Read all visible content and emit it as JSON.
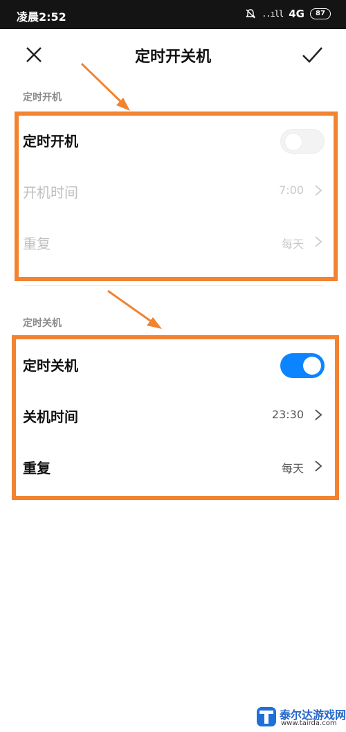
{
  "status_bar": {
    "time": "凌晨2:52",
    "signal_text": "..ıll",
    "network": "4G",
    "battery": "87",
    "icons": [
      "alarm-off-icon",
      "signal-icon",
      "battery-icon"
    ]
  },
  "header": {
    "title": "定时开关机",
    "close_icon": "close-icon",
    "confirm_icon": "check-icon"
  },
  "power_on": {
    "section_label": "定时开机",
    "toggle_label": "定时开机",
    "toggle_on": false,
    "time_label": "开机时间",
    "time_value": "7:00",
    "repeat_label": "重复",
    "repeat_value": "每天"
  },
  "power_off": {
    "section_label": "定时关机",
    "toggle_label": "定时关机",
    "toggle_on": true,
    "time_label": "关机时间",
    "time_value": "23:30",
    "repeat_label": "重复",
    "repeat_value": "每天"
  },
  "watermark": {
    "name": "泰尔达游戏网",
    "url": "www.tairda.com"
  },
  "colors": {
    "status_bg": "#141414",
    "accent_blue": "#0d84ff",
    "annotation_orange": "#f28330",
    "disabled_text": "#c0c0c0"
  }
}
